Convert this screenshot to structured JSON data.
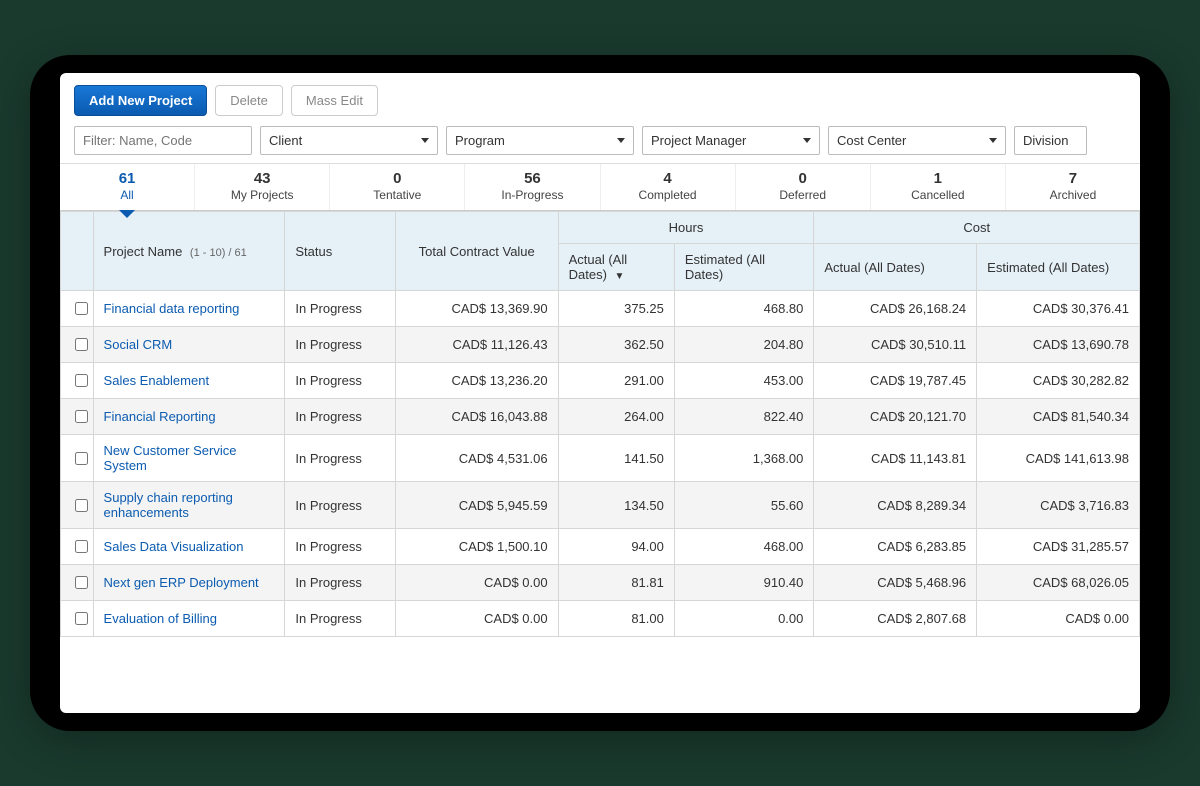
{
  "toolbar": {
    "add_label": "Add New Project",
    "delete_label": "Delete",
    "mass_edit_label": "Mass Edit"
  },
  "filters": {
    "text_placeholder": "Filter: Name, Code",
    "client": "Client",
    "program": "Program",
    "project_manager": "Project Manager",
    "cost_center": "Cost Center",
    "division": "Division"
  },
  "status_tabs": [
    {
      "count": "61",
      "label": "All",
      "active": true
    },
    {
      "count": "43",
      "label": "My Projects"
    },
    {
      "count": "0",
      "label": "Tentative"
    },
    {
      "count": "56",
      "label": "In-Progress"
    },
    {
      "count": "4",
      "label": "Completed"
    },
    {
      "count": "0",
      "label": "Deferred"
    },
    {
      "count": "1",
      "label": "Cancelled"
    },
    {
      "count": "7",
      "label": "Archived"
    }
  ],
  "headers": {
    "project_name": "Project Name",
    "range": "(1 - 10) / 61",
    "status": "Status",
    "tcv": "Total Contract Value",
    "hours_group": "Hours",
    "cost_group": "Cost",
    "actual_all": "Actual (All Dates)",
    "estimated_all": "Estimated (All Dates)",
    "sort_desc": "▼"
  },
  "rows": [
    {
      "name": "Financial data reporting",
      "status": "In Progress",
      "tcv": "CAD$ 13,369.90",
      "h_act": "375.25",
      "h_est": "468.80",
      "c_act": "CAD$ 26,168.24",
      "c_est": "CAD$ 30,376.41"
    },
    {
      "name": "Social CRM",
      "status": "In Progress",
      "tcv": "CAD$ 11,126.43",
      "h_act": "362.50",
      "h_est": "204.80",
      "c_act": "CAD$ 30,510.11",
      "c_est": "CAD$ 13,690.78"
    },
    {
      "name": "Sales Enablement",
      "status": "In Progress",
      "tcv": "CAD$ 13,236.20",
      "h_act": "291.00",
      "h_est": "453.00",
      "c_act": "CAD$ 19,787.45",
      "c_est": "CAD$ 30,282.82"
    },
    {
      "name": "Financial Reporting",
      "status": "In Progress",
      "tcv": "CAD$ 16,043.88",
      "h_act": "264.00",
      "h_est": "822.40",
      "c_act": "CAD$ 20,121.70",
      "c_est": "CAD$ 81,540.34"
    },
    {
      "name": "New Customer Service System",
      "status": "In Progress",
      "tcv": "CAD$ 4,531.06",
      "h_act": "141.50",
      "h_est": "1,368.00",
      "c_act": "CAD$ 11,143.81",
      "c_est": "CAD$ 141,613.98"
    },
    {
      "name": "Supply chain reporting enhancements",
      "status": "In Progress",
      "tcv": "CAD$ 5,945.59",
      "h_act": "134.50",
      "h_est": "55.60",
      "c_act": "CAD$ 8,289.34",
      "c_est": "CAD$ 3,716.83"
    },
    {
      "name": "Sales Data Visualization",
      "status": "In Progress",
      "tcv": "CAD$ 1,500.10",
      "h_act": "94.00",
      "h_est": "468.00",
      "c_act": "CAD$ 6,283.85",
      "c_est": "CAD$ 31,285.57"
    },
    {
      "name": "Next gen ERP Deployment",
      "status": "In Progress",
      "tcv": "CAD$ 0.00",
      "h_act": "81.81",
      "h_est": "910.40",
      "c_act": "CAD$ 5,468.96",
      "c_est": "CAD$ 68,026.05"
    },
    {
      "name": "Evaluation of Billing",
      "status": "In Progress",
      "tcv": "CAD$ 0.00",
      "h_act": "81.00",
      "h_est": "0.00",
      "c_act": "CAD$ 2,807.68",
      "c_est": "CAD$ 0.00"
    }
  ]
}
